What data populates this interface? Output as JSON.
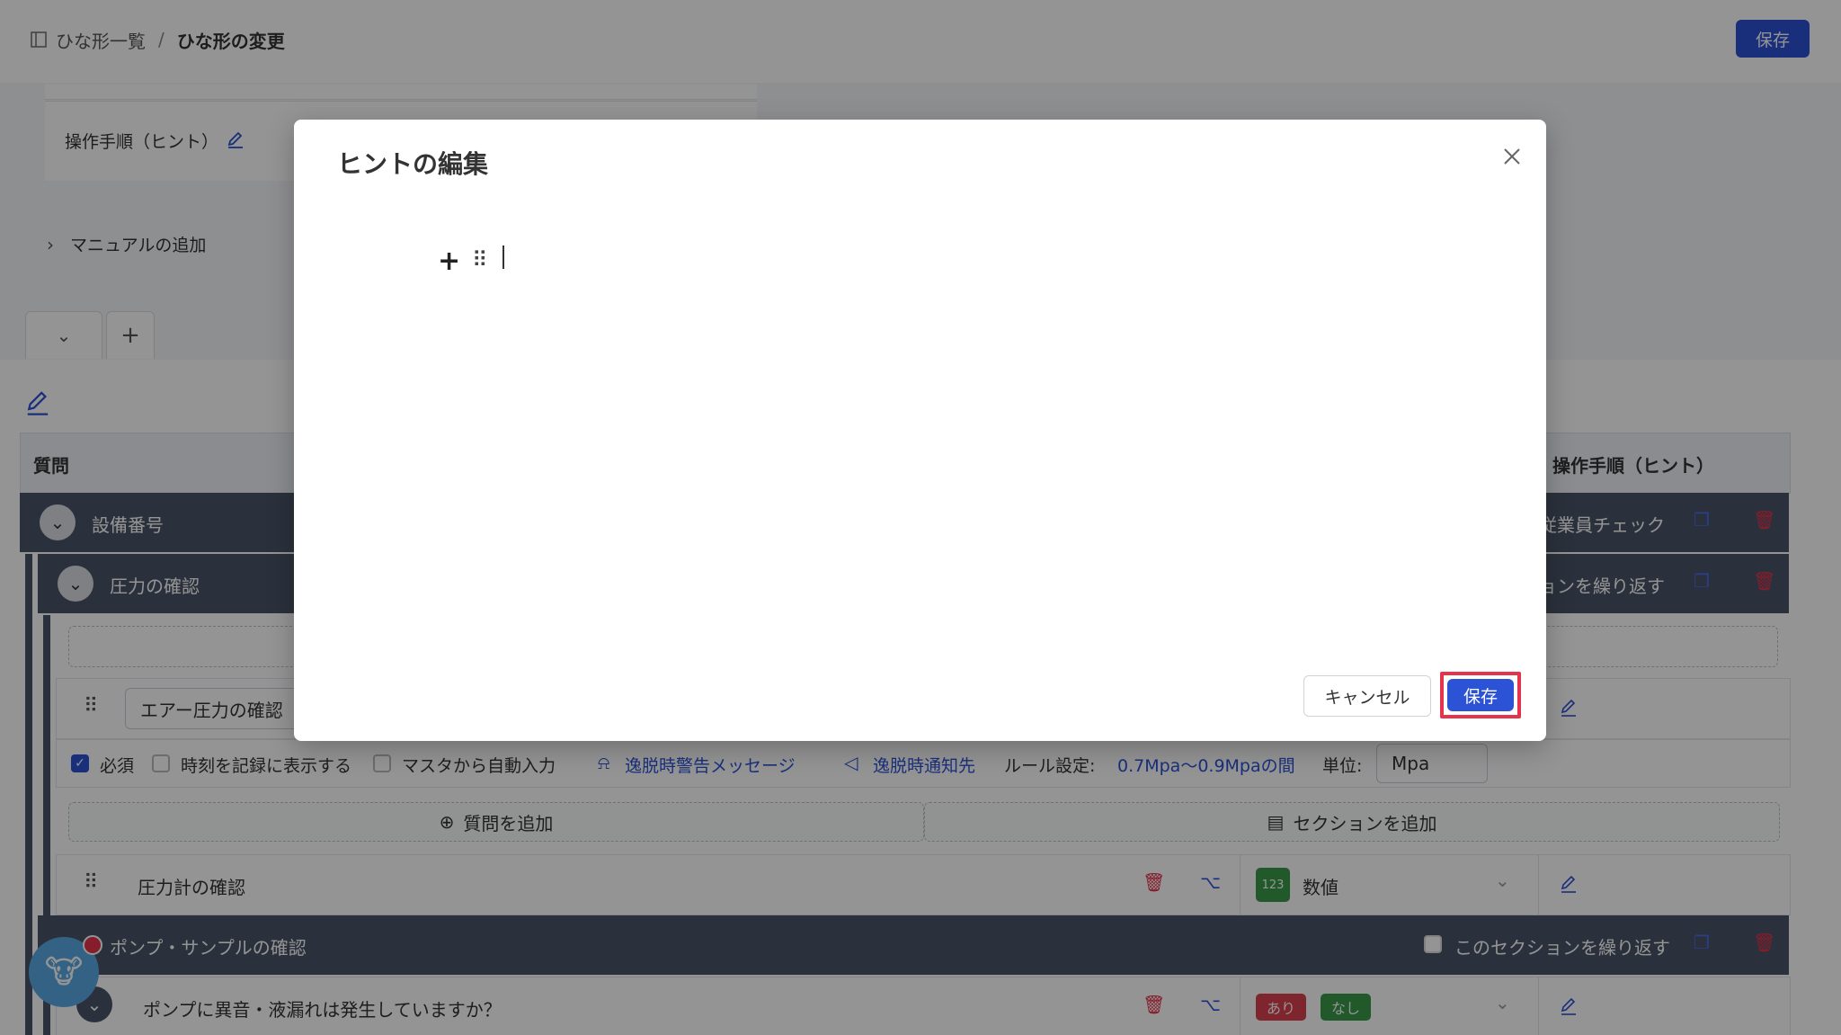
{
  "header": {
    "breadcrumb_root": "ひな形一覧",
    "breadcrumb_sep": "/",
    "breadcrumb_current": "ひな形の変更",
    "save_label": "保存"
  },
  "upper": {
    "hint_label": "操作手順（ヒント）",
    "manual_add": "マニュアルの追加",
    "tab_add": "+"
  },
  "table": {
    "col_question": "質問",
    "col_hint": "操作手順（ヒント）",
    "rows": {
      "equipment": "設備番号",
      "equipment_right": "従業員チェック",
      "pressure": "圧力の確認",
      "pressure_right": "ョンを繰り返す",
      "air_pressure": "エアー圧力の確認",
      "required": "必須",
      "show_time": "時刻を記録に表示する",
      "auto_master": "マスタから自動入力",
      "warn_msg": "逸脱時警告メッセージ",
      "notify": "逸脱時通知先",
      "rule_label": "ルール設定:",
      "rule_value": "0.7Mpa〜0.9Mpaの間",
      "unit_label": "単位:",
      "unit_value": "Mpa",
      "add_question": "質問を追加",
      "add_section": "セクションを追加",
      "gauge": "圧力計の確認",
      "gauge_type": "数値",
      "gauge_badge": "123",
      "pump_section": "ポンプ・サンプルの確認",
      "repeat_section": "このセクションを繰り返す",
      "pump_question": "ポンプに異音・液漏れは発生していますか？",
      "yes": "あり",
      "no": "なし"
    }
  },
  "modal": {
    "title": "ヒントの編集",
    "cancel_label": "キャンセル",
    "save_label": "保存"
  },
  "colors": {
    "primary": "#2c52d6",
    "danger": "#e5334b",
    "dark_row": "#4a5568",
    "badge_green": "#3a9a4a"
  }
}
